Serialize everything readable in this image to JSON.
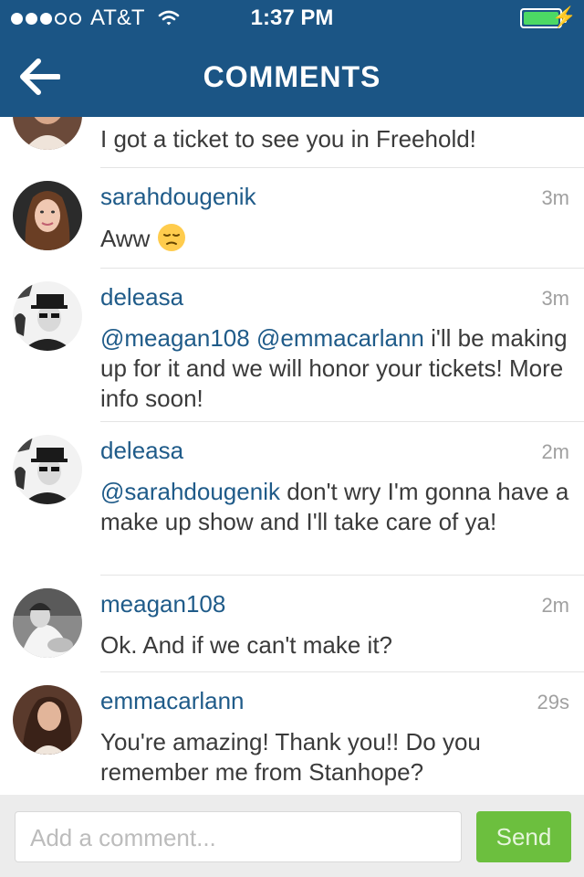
{
  "status_bar": {
    "carrier": "AT&T",
    "time": "1:37 PM",
    "signal_bars": 3,
    "signal_total": 5
  },
  "nav": {
    "title": "COMMENTS",
    "back_icon": "back-arrow-icon"
  },
  "comments": [
    {
      "username": "",
      "time": "",
      "segments": [
        {
          "type": "text",
          "value": "I got a ticket to see you in Freehold!"
        }
      ]
    },
    {
      "username": "sarahdougenik",
      "time": "3m",
      "segments": [
        {
          "type": "text",
          "value": "Aww "
        }
      ],
      "emoji": "pensive-face-emoji"
    },
    {
      "username": "deleasa",
      "time": "3m",
      "segments": [
        {
          "type": "mention",
          "value": "@meagan108"
        },
        {
          "type": "text",
          "value": " "
        },
        {
          "type": "mention",
          "value": "@emmacarlann"
        },
        {
          "type": "text",
          "value": " i'll be making up for it and we will honor your tickets! More info soon!"
        }
      ]
    },
    {
      "username": "deleasa",
      "time": "2m",
      "segments": [
        {
          "type": "mention",
          "value": "@sarahdougenik"
        },
        {
          "type": "text",
          "value": " don't wry I'm gonna have a make up show and I'll take care of ya!"
        }
      ]
    },
    {
      "username": "meagan108",
      "time": "2m",
      "segments": [
        {
          "type": "text",
          "value": "Ok. And if we can't make it?"
        }
      ]
    },
    {
      "username": "emmacarlann",
      "time": "29s",
      "segments": [
        {
          "type": "text",
          "value": "You're amazing! Thank you!! Do you remember me from Stanhope?"
        }
      ]
    }
  ],
  "comment_input": {
    "placeholder": "Add a comment...",
    "send_label": "Send"
  },
  "colors": {
    "header": "#1b5585",
    "username": "#1f5b89",
    "send": "#6cbf3e",
    "battery": "#4cd964"
  }
}
